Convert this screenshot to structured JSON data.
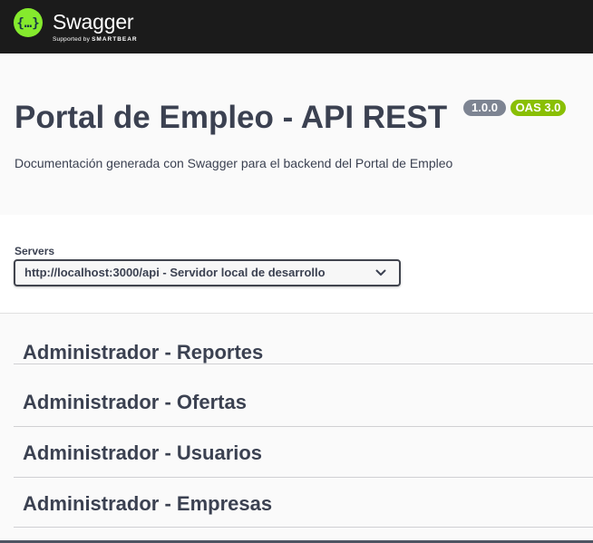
{
  "topbar": {
    "logo_title": "Swagger",
    "logo_sub_prefix": "Supported by",
    "logo_sub_brand": "SMARTBEAR",
    "logo_icon": "swagger-logo-icon",
    "brand_color": "#85ea2d"
  },
  "info": {
    "title": "Portal de Empleo - API REST",
    "version": "1.0.0",
    "oas": "OAS 3.0",
    "description": "Documentación generada con Swagger para el backend del Portal de Empleo"
  },
  "servers": {
    "label": "Servers",
    "selected": "http://localhost:3000/api - Servidor local de desarrollo"
  },
  "tags": [
    {
      "label": "Administrador - Reportes"
    },
    {
      "label": "Administrador - Ofertas"
    },
    {
      "label": "Administrador - Usuarios"
    },
    {
      "label": "Administrador - Empresas"
    }
  ],
  "colors": {
    "topbar": "#1b1b1b",
    "version_badge": "#7d8492",
    "oas_badge": "#89bf04",
    "text": "#3b4151"
  }
}
